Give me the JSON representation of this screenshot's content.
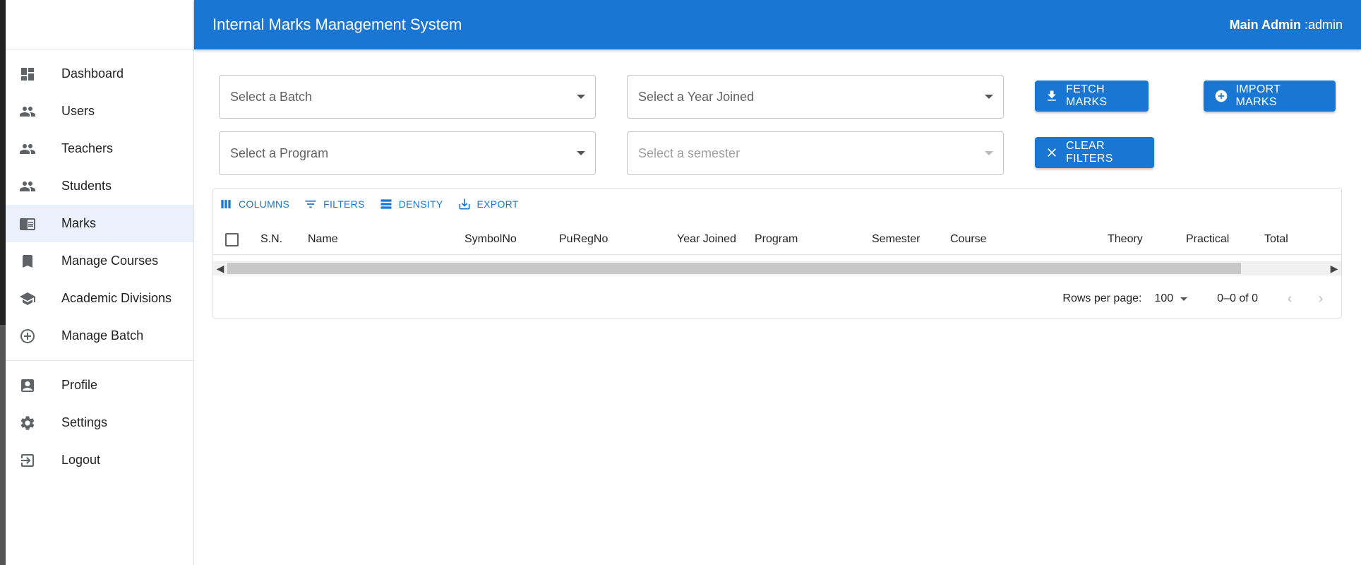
{
  "app": {
    "title": "Internal Marks Management System",
    "user_role": "Main Admin",
    "user_name": ":admin"
  },
  "sidebar": {
    "items": [
      {
        "label": "Dashboard",
        "icon": "dashboard-icon"
      },
      {
        "label": "Users",
        "icon": "people-icon"
      },
      {
        "label": "Teachers",
        "icon": "people-icon"
      },
      {
        "label": "Students",
        "icon": "people-icon"
      },
      {
        "label": "Marks",
        "icon": "chrome-reader-icon",
        "active": true
      },
      {
        "label": "Manage Courses",
        "icon": "bookmark-icon"
      },
      {
        "label": "Academic Divisions",
        "icon": "school-icon"
      },
      {
        "label": "Manage Batch",
        "icon": "add-circle-icon"
      }
    ],
    "secondary_items": [
      {
        "label": "Profile",
        "icon": "account-box-icon"
      },
      {
        "label": "Settings",
        "icon": "gear-icon"
      },
      {
        "label": "Logout",
        "icon": "logout-icon"
      }
    ]
  },
  "filters": {
    "batch_placeholder": "Select a Batch",
    "year_placeholder": "Select a Year Joined",
    "program_placeholder": "Select a Program",
    "semester_placeholder": "Select a semester"
  },
  "actions": {
    "fetch_label": "FETCH MARKS",
    "import_label": "IMPORT MARKS",
    "clear_label": "CLEAR FILTERS"
  },
  "grid": {
    "toolbar": {
      "columns": "COLUMNS",
      "filters": "FILTERS",
      "density": "DENSITY",
      "export": "EXPORT"
    },
    "columns": [
      "S.N.",
      "Name",
      "SymbolNo",
      "PuRegNo",
      "Year Joined",
      "Program",
      "Semester",
      "Course",
      "Theory",
      "Practical",
      "Total"
    ],
    "footer": {
      "rows_per_page_label": "Rows per page:",
      "rows_per_page_value": "100",
      "range": "0–0 of 0"
    }
  },
  "colors": {
    "primary": "#1976d2",
    "active_nav_bg": "#eaf1fb"
  }
}
